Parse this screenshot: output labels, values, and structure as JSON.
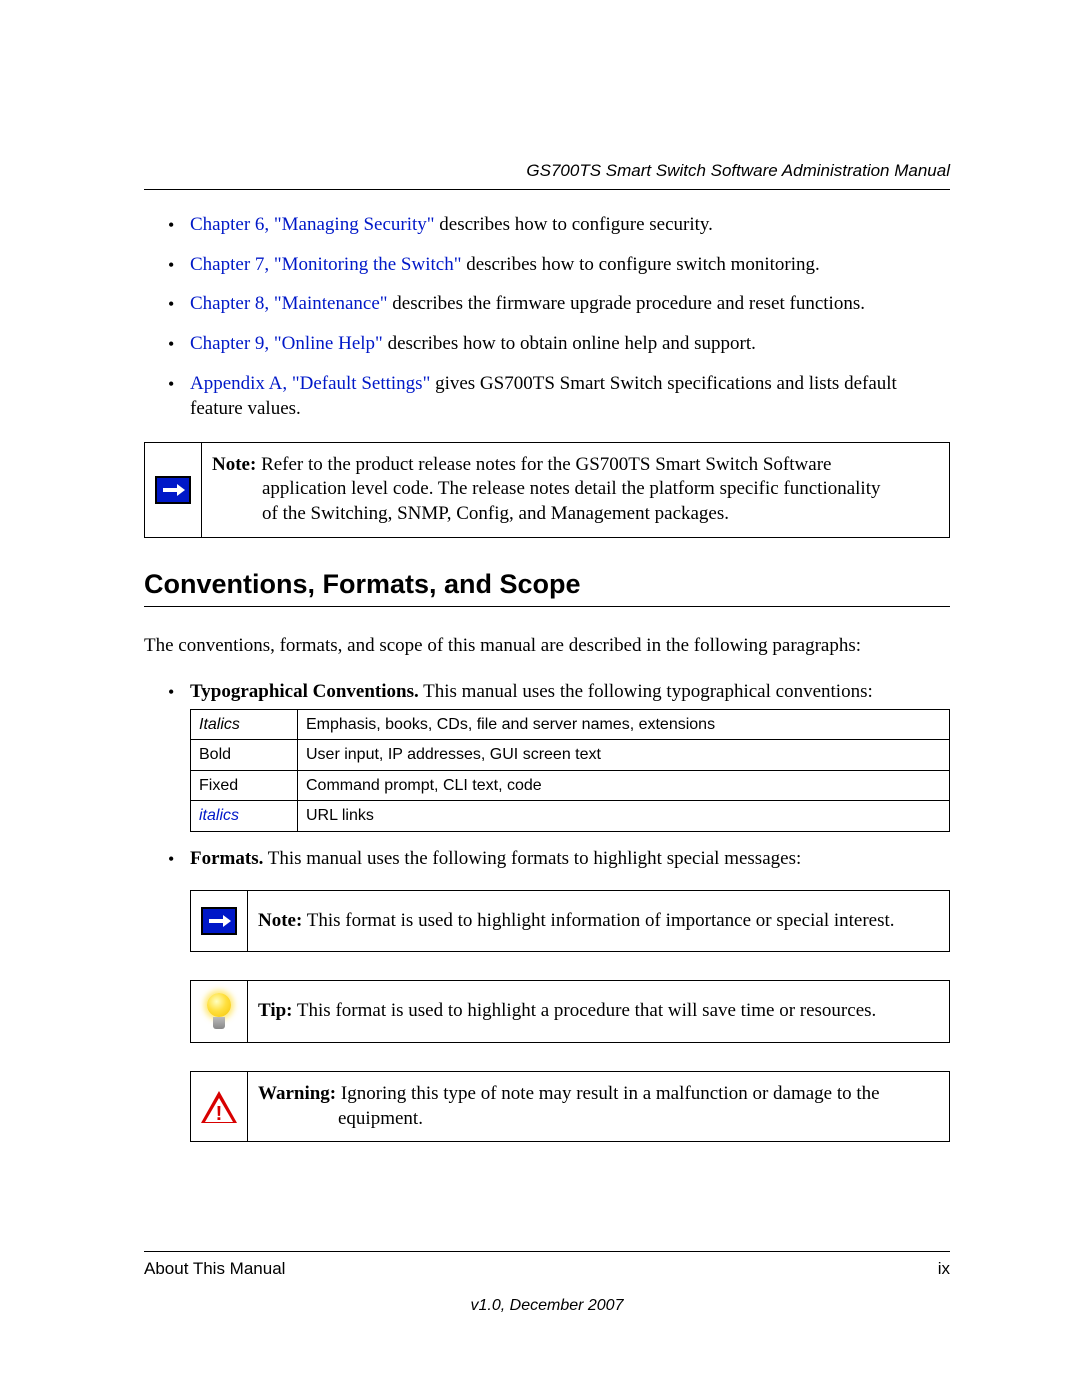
{
  "header": {
    "title": "GS700TS Smart Switch Software Administration Manual"
  },
  "bullets": [
    {
      "link": "Chapter 6, \"Managing Security\"",
      "rest": " describes how to configure security."
    },
    {
      "link": "Chapter 7, \"Monitoring the Switch\"",
      "rest": " describes how to configure switch monitoring."
    },
    {
      "link": "Chapter 8, \"Maintenance\"",
      "rest": " describes the firmware upgrade procedure and reset functions."
    },
    {
      "link": "Chapter 9, \"Online Help\"",
      "rest": " describes how to obtain online help and support."
    },
    {
      "link": "Appendix A, \"Default Settings\"",
      "rest": " gives GS700TS Smart Switch specifications and lists default feature values."
    }
  ],
  "note_top": {
    "label": "Note:",
    "first": " Refer to the product release notes for the GS700TS Smart Switch Software",
    "cont1": "application level code. The release notes detail the platform specific functionality",
    "cont2": "of the Switching, SNMP, Config, and Management packages."
  },
  "section_heading": "Conventions, Formats, and Scope",
  "intro_para": "The conventions, formats, and scope of this manual are described in the following paragraphs:",
  "conv_bullet": {
    "lead": "Typographical Conventions.",
    "rest": " This manual uses the following typographical conventions:"
  },
  "conv_table": [
    {
      "c1": "Italics",
      "style1": "italic-style",
      "c2": "Emphasis, books, CDs, file and server names, extensions"
    },
    {
      "c1": "Bold",
      "style1": "",
      "c2": "User input, IP addresses, GUI screen text"
    },
    {
      "c1": "Fixed",
      "style1": "",
      "c2": "Command prompt, CLI text, code"
    },
    {
      "c1": "italics",
      "style1": "link-italic",
      "c2": "URL links"
    }
  ],
  "formats_bullet": {
    "lead": "Formats.",
    "rest": " This manual uses the following formats to highlight special messages:"
  },
  "format_note": {
    "label": "Note:",
    "text": " This format is used to highlight information of importance or special interest."
  },
  "format_tip": {
    "label": "Tip:",
    "text": " This format is used to highlight a procedure that will save time or resources."
  },
  "format_warn": {
    "label": "Warning:",
    "first": " Ignoring this type of note may result in a malfunction or damage to the",
    "cont1": "equipment."
  },
  "footer": {
    "left": "About This Manual",
    "right": "ix",
    "version": "v1.0, December 2007"
  }
}
